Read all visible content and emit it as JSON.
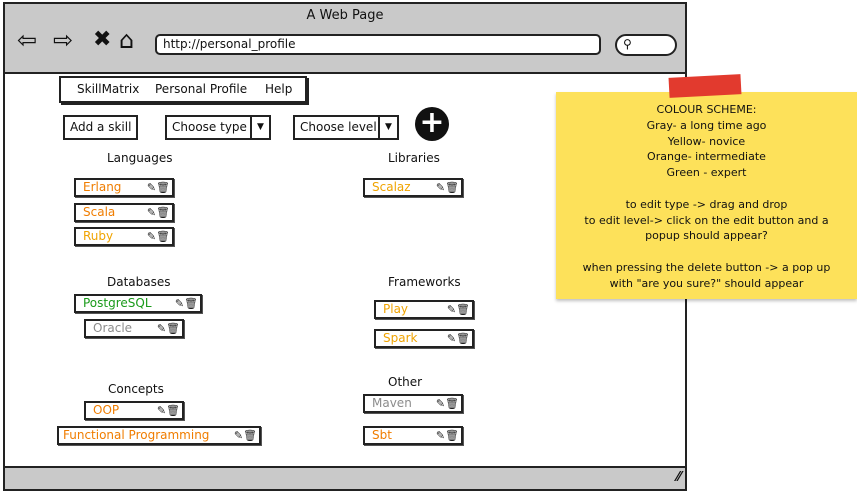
{
  "window": {
    "title": "A Web Page"
  },
  "toolbar": {
    "back_icon": "back-arrow-icon",
    "forward_icon": "forward-arrow-icon",
    "stop_icon": "close-icon",
    "home_icon": "home-icon",
    "url": "http://personal_profile",
    "search_icon": "search-icon"
  },
  "menu": {
    "items": [
      "SkillMatrix",
      "Personal Profile",
      "Help"
    ]
  },
  "controls": {
    "add_skill": "Add a skill",
    "type_select": "Choose type",
    "level_select": "Choose level",
    "add_icon": "plus-circle-icon"
  },
  "categories": {
    "languages": {
      "label": "Languages",
      "skills": [
        {
          "name": "Erlang",
          "level": "intermediate"
        },
        {
          "name": "Scala",
          "level": "intermediate"
        },
        {
          "name": "Ruby",
          "level": "novice"
        }
      ]
    },
    "libraries": {
      "label": "Libraries",
      "skills": [
        {
          "name": "Scalaz",
          "level": "novice"
        }
      ]
    },
    "databases": {
      "label": "Databases",
      "skills": [
        {
          "name": "PostgreSQL",
          "level": "expert"
        },
        {
          "name": "Oracle",
          "level": "long time ago"
        }
      ]
    },
    "frameworks": {
      "label": "Frameworks",
      "skills": [
        {
          "name": "Play",
          "level": "novice"
        },
        {
          "name": "Spark",
          "level": "novice"
        }
      ]
    },
    "concepts": {
      "label": "Concepts",
      "skills": [
        {
          "name": "OOP",
          "level": "intermediate"
        },
        {
          "name": "Functional Programming",
          "level": "intermediate"
        }
      ]
    },
    "other": {
      "label": "Other",
      "skills": [
        {
          "name": "Maven",
          "level": "long time ago"
        },
        {
          "name": "Sbt",
          "level": "intermediate"
        }
      ]
    }
  },
  "skill_icons": {
    "edit": "edit-icon",
    "delete": "trash-icon"
  },
  "colors": {
    "long_time_ago": "#8c8c8c",
    "novice": "#f0a300",
    "intermediate": "#f07d00",
    "expert": "#1a9a1a",
    "note": "#fde15a",
    "tape": "#e23a2e"
  },
  "note": {
    "lines": [
      "COLOUR SCHEME:",
      "Gray- a long time ago",
      "Yellow- novice",
      "Orange- intermediate",
      "Green - expert",
      "",
      "to edit type -> drag and drop",
      "to edit level-> click on the edit button and a",
      "popup should appear?",
      "",
      "when pressing the delete button -> a pop up",
      "with \"are you sure?\" should appear"
    ]
  }
}
